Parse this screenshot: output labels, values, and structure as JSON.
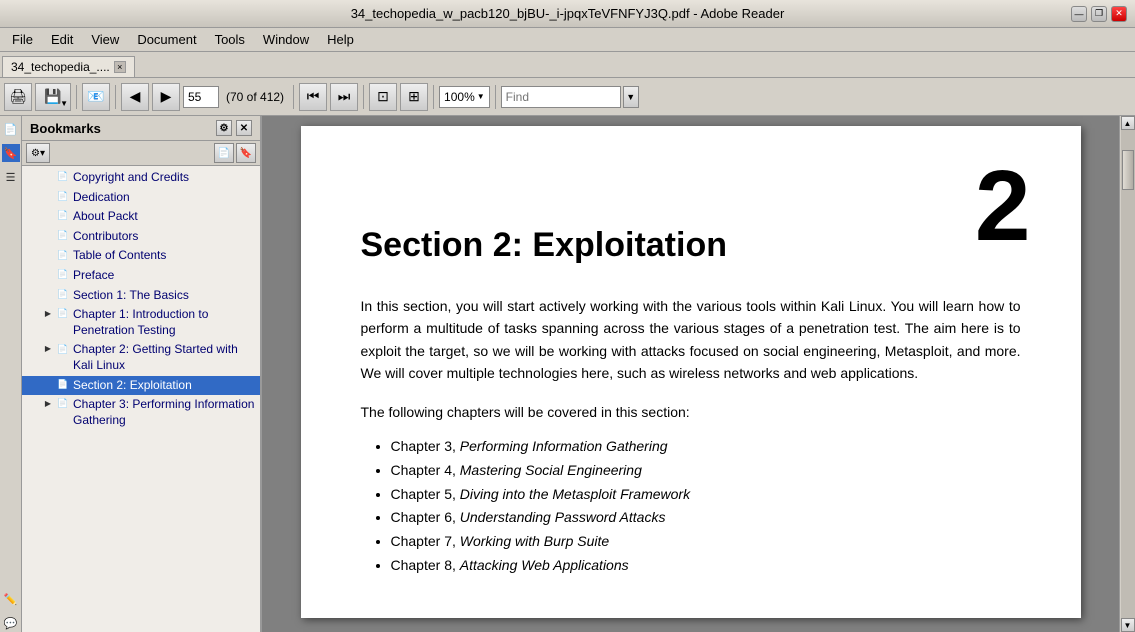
{
  "titlebar": {
    "title": "34_techopedia_w_pacb120_bjBU-_i-jpqxTeVFNFYJ3Q.pdf - Adobe Reader"
  },
  "window_controls": {
    "minimize": "—",
    "restore": "❐",
    "close": "✕"
  },
  "menubar": {
    "items": [
      "File",
      "Edit",
      "View",
      "Document",
      "Tools",
      "Window",
      "Help"
    ]
  },
  "tab": {
    "label": "34_techopedia_....",
    "close": "×"
  },
  "toolbar": {
    "page_number": "55",
    "page_info": "(70 of 412)",
    "zoom": "100%",
    "find_placeholder": "Find"
  },
  "bookmarks": {
    "header": "Bookmarks",
    "items": [
      {
        "id": "copyright",
        "label": "Copyright and Credits",
        "indent": 1,
        "expandable": false
      },
      {
        "id": "dedication",
        "label": "Dedication",
        "indent": 1,
        "expandable": false
      },
      {
        "id": "about-packt",
        "label": "About Packt",
        "indent": 1,
        "expandable": false
      },
      {
        "id": "contributors",
        "label": "Contributors",
        "indent": 1,
        "expandable": false
      },
      {
        "id": "toc",
        "label": "Table of Contents",
        "indent": 1,
        "expandable": false
      },
      {
        "id": "preface",
        "label": "Preface",
        "indent": 1,
        "expandable": false
      },
      {
        "id": "section1",
        "label": "Section 1: The Basics",
        "indent": 1,
        "expandable": false
      },
      {
        "id": "chapter1",
        "label": "Chapter 1: Introduction to Penetration Testing",
        "indent": 1,
        "expandable": true,
        "expanded": true
      },
      {
        "id": "chapter2",
        "label": "Chapter 2: Getting Started with Kali Linux",
        "indent": 1,
        "expandable": true,
        "expanded": false
      },
      {
        "id": "section2",
        "label": "Section 2: Exploitation",
        "indent": 1,
        "expandable": false,
        "active": true
      },
      {
        "id": "chapter3",
        "label": "Chapter 3: Performing Information Gathering",
        "indent": 1,
        "expandable": true,
        "expanded": false
      }
    ]
  },
  "pdf": {
    "page_number_display": "2",
    "section_title": "Section 2: Exploitation",
    "body1": "In this section, you will start actively working with the various tools within Kali Linux. You will learn how to perform a multitude of tasks spanning across the various stages of a penetration test. The aim here is to exploit the target, so we will be working with attacks focused on social engineering, Metasploit, and more. We will cover multiple technologies here, such as wireless networks and web applications.",
    "body2": "The following chapters will be covered in this section:",
    "chapters": [
      {
        "label": "Chapter 3, ",
        "italic": "Performing Information Gathering"
      },
      {
        "label": "Chapter 4, ",
        "italic": "Mastering Social Engineering"
      },
      {
        "label": "Chapter 5, ",
        "italic": "Diving into the Metasploit Framework"
      },
      {
        "label": "Chapter 6, ",
        "italic": "Understanding Password Attacks"
      },
      {
        "label": "Chapter 7, ",
        "italic": "Working with Burp Suite"
      },
      {
        "label": "Chapter 8, ",
        "italic": "Attacking Web Applications"
      }
    ]
  }
}
